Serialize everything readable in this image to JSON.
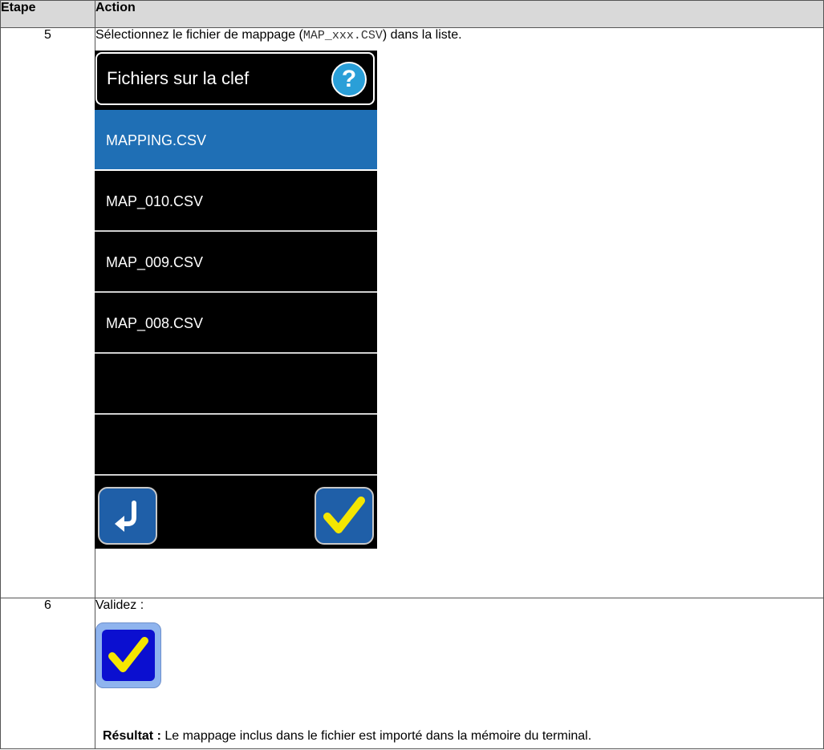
{
  "table": {
    "headers": {
      "step": "Etape",
      "action": "Action"
    },
    "rows": [
      {
        "step": "5",
        "text_before": "Sélectionnez le fichier de mappage (",
        "code": "MAP_xxx.CSV",
        "text_after": ") dans la liste.",
        "screen": {
          "title": "Fichiers sur la clef",
          "help_icon": "question-mark-icon",
          "files": [
            "MAPPING.CSV",
            "MAP_010.CSV",
            "MAP_009.CSV",
            "MAP_008.CSV",
            "",
            ""
          ],
          "selected_index": 0,
          "back_icon": "return-arrow-icon",
          "ok_icon": "checkmark-icon"
        }
      },
      {
        "step": "6",
        "text": "Validez :",
        "icon": "validate-checkmark-icon",
        "result_label": "Résultat :",
        "result_text": " Le mappage inclus dans le fichier est importé dans la mémoire du terminal."
      }
    ]
  },
  "colors": {
    "header_bg": "#d9d9d9",
    "selected_row": "#1f6fb5",
    "help_icon": "#2a9fd8",
    "check_yellow": "#f5e600"
  }
}
